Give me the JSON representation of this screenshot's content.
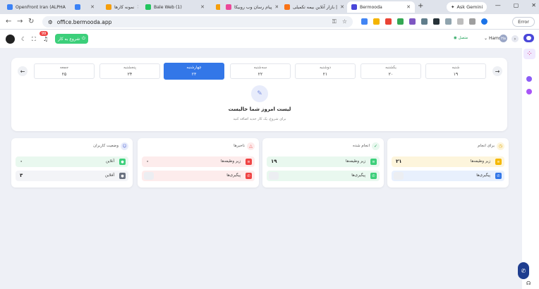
{
  "browser": {
    "tabs": [
      {
        "title": "OpenFront Iran (ALPHA",
        "color": "#3b82f6"
      },
      {
        "title": "",
        "color": "#3b82f6"
      },
      {
        "title": "نمونه کارها",
        "color": "#f59e0b"
      },
      {
        "title": "Bale Web (1)",
        "color": "#22c55e"
      },
      {
        "title": "",
        "color": "#f59e0b"
      },
      {
        "title": "پیام رسان وب روبیکا",
        "color": "#ec4899"
      },
      {
        "title": "بازار آنلاین بیمه تکمیلی |",
        "color": "#f97316"
      },
      {
        "title": "Bermooda",
        "color": "#4a47d9"
      }
    ],
    "new_tab": "+",
    "ask_gemini": "Ask Gemini",
    "url": "office.bermooda.app",
    "error_label": "Error",
    "window_buttons": [
      "—",
      "▢",
      "✕"
    ]
  },
  "header": {
    "start_work_label": "شروع به کار",
    "notification_count": "99",
    "online_label": "متصل",
    "user_name": "Hamsa",
    "user_initials": "Ha"
  },
  "week": {
    "days": [
      {
        "name": "جمعه",
        "date": "۲۵"
      },
      {
        "name": "پنجشنبه",
        "date": "۲۴"
      },
      {
        "name": "چهارشنبه",
        "date": "۲۳",
        "active": true
      },
      {
        "name": "سه‌شنبه",
        "date": "۲۲"
      },
      {
        "name": "دوشنبه",
        "date": "۲۱"
      },
      {
        "name": "یکشنبه",
        "date": "۲۰"
      },
      {
        "name": "شنبه",
        "date": "۱۹"
      }
    ],
    "empty_title": "لیست امروز شما خالیست",
    "empty_subtitle": "برای شروع، یک کار جدید اضافه کنید"
  },
  "cards": [
    {
      "title": "وضعیت کاربران",
      "rows": [
        {
          "label": "آنلاین",
          "value": "۰",
          "bg": "#e9f8ef",
          "icon_bg": "#3ccf7a"
        },
        {
          "label": "آفلاین",
          "value": "۳",
          "bg": "#f3f4f7",
          "icon_bg": "#6b7280"
        }
      ]
    },
    {
      "title": "ناخبرها",
      "rows": [
        {
          "label": "زیر وظیفه‌ها",
          "value": "۰",
          "bg": "#fdecec",
          "icon_bg": "#ef4444"
        },
        {
          "label": "پیگیری‌ها",
          "value": "",
          "bg": "#fdecec",
          "icon_bg": "#ef4444"
        }
      ]
    },
    {
      "title": "انجام شده",
      "rows": [
        {
          "label": "زیر وظیفه‌ها",
          "value": "۱۹",
          "bg": "#e9f8ef",
          "icon_bg": "#3ccf7a"
        },
        {
          "label": "پیگیری‌ها",
          "value": "",
          "bg": "#e9f8ef",
          "icon_bg": "#3ccf7a"
        }
      ]
    },
    {
      "title": "برای انجام",
      "rows": [
        {
          "label": "زیر وظیفه‌ها",
          "value": "۲۱",
          "bg": "#fdf5dc",
          "icon_bg": "#f5b800"
        },
        {
          "label": "پیگیری‌ها",
          "value": "",
          "bg": "#e8f0fd",
          "icon_bg": "#3377e8"
        }
      ]
    }
  ]
}
